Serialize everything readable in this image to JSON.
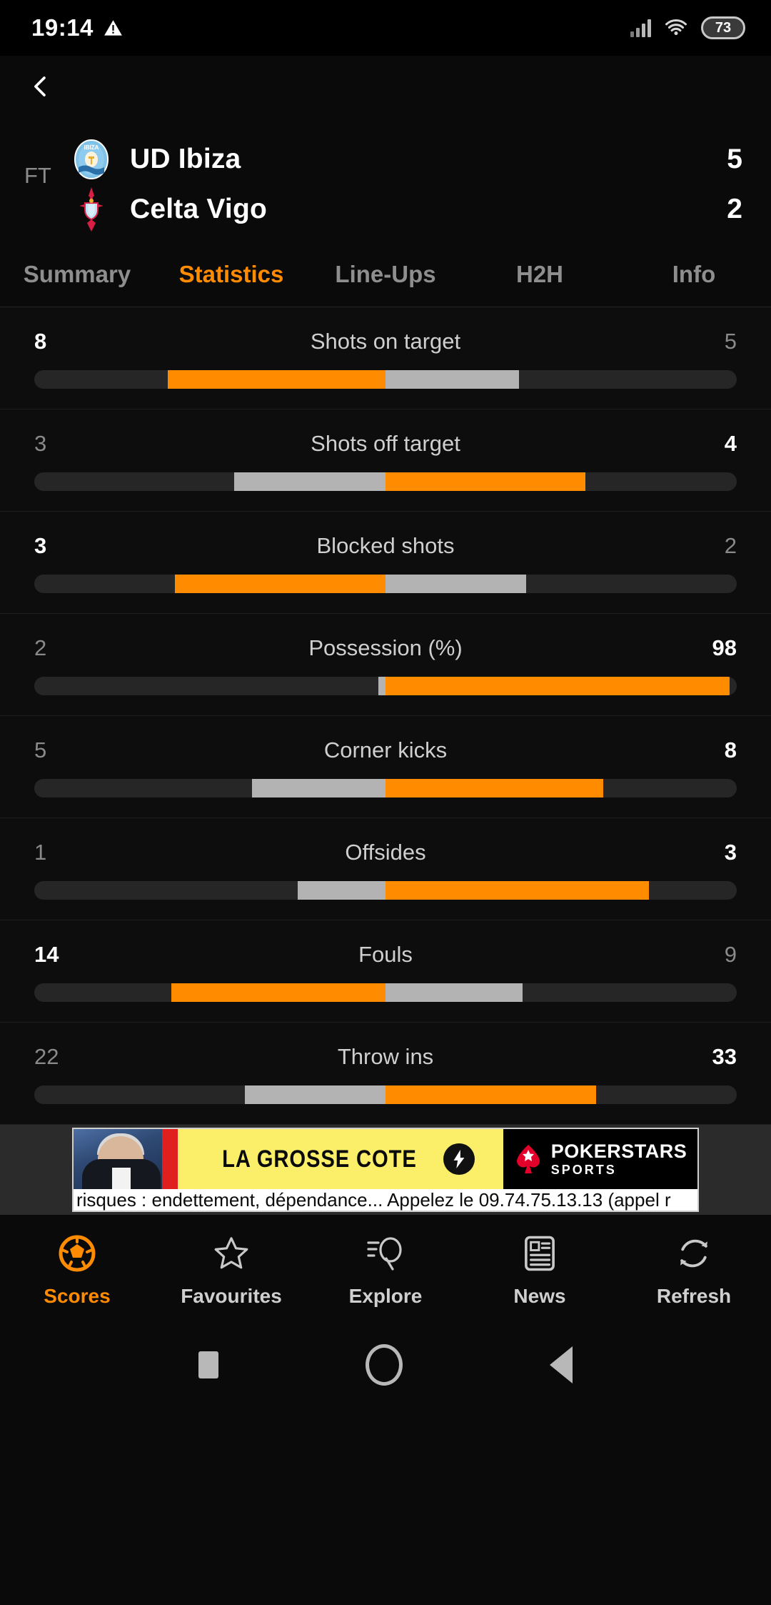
{
  "status_bar": {
    "time": "19:14",
    "warning_icon": "warning-triangle-icon",
    "signal_icon": "cellular-signal-icon",
    "wifi_icon": "wifi-icon",
    "battery_level": "73"
  },
  "header": {
    "back_icon": "chevron-left-icon",
    "match_status": "FT",
    "home_team": "UD Ibiza",
    "away_team": "Celta Vigo",
    "home_score": "5",
    "away_score": "2",
    "home_crest": "ud-ibiza-crest",
    "away_crest": "celta-vigo-crest",
    "accent_color": "#ff8c00"
  },
  "tabs": [
    {
      "label": "Summary",
      "active": false
    },
    {
      "label": "Statistics",
      "active": true
    },
    {
      "label": "Line-Ups",
      "active": false
    },
    {
      "label": "H2H",
      "active": false
    },
    {
      "label": "Info",
      "active": false
    }
  ],
  "stats": [
    {
      "label": "Shots on target",
      "home": "8",
      "away": "5",
      "home_pct": 62,
      "away_pct": 38
    },
    {
      "label": "Shots off target",
      "home": "3",
      "away": "4",
      "home_pct": 43,
      "away_pct": 57
    },
    {
      "label": "Blocked shots",
      "home": "3",
      "away": "2",
      "home_pct": 60,
      "away_pct": 40
    },
    {
      "label": "Possession (%)",
      "home": "2",
      "away": "98",
      "home_pct": 2,
      "away_pct": 98
    },
    {
      "label": "Corner kicks",
      "home": "5",
      "away": "8",
      "home_pct": 38,
      "away_pct": 62
    },
    {
      "label": "Offsides",
      "home": "1",
      "away": "3",
      "home_pct": 25,
      "away_pct": 75
    },
    {
      "label": "Fouls",
      "home": "14",
      "away": "9",
      "home_pct": 61,
      "away_pct": 39
    },
    {
      "label": "Throw ins",
      "home": "22",
      "away": "33",
      "home_pct": 40,
      "away_pct": 60
    }
  ],
  "ad": {
    "slogan": "LA GROSSE COTE",
    "brand_line1": "POKERSTARS",
    "brand_line2": "SPORTS",
    "disclaimer": "risques : endettement, dépendance... Appelez le 09.74.75.13.13 (appel r",
    "bolt_icon": "lightning-bolt-icon",
    "spade_icon": "pokerstars-spade-icon"
  },
  "bottom_nav": [
    {
      "label": "Scores",
      "icon": "football-icon",
      "active": true
    },
    {
      "label": "Favourites",
      "icon": "star-icon",
      "active": false
    },
    {
      "label": "Explore",
      "icon": "search-icon",
      "active": false
    },
    {
      "label": "News",
      "icon": "newspaper-icon",
      "active": false
    },
    {
      "label": "Refresh",
      "icon": "refresh-icon",
      "active": false
    }
  ],
  "system_nav": {
    "recents_icon": "square-recents-icon",
    "home_icon": "circle-home-icon",
    "back_icon": "triangle-back-icon"
  }
}
